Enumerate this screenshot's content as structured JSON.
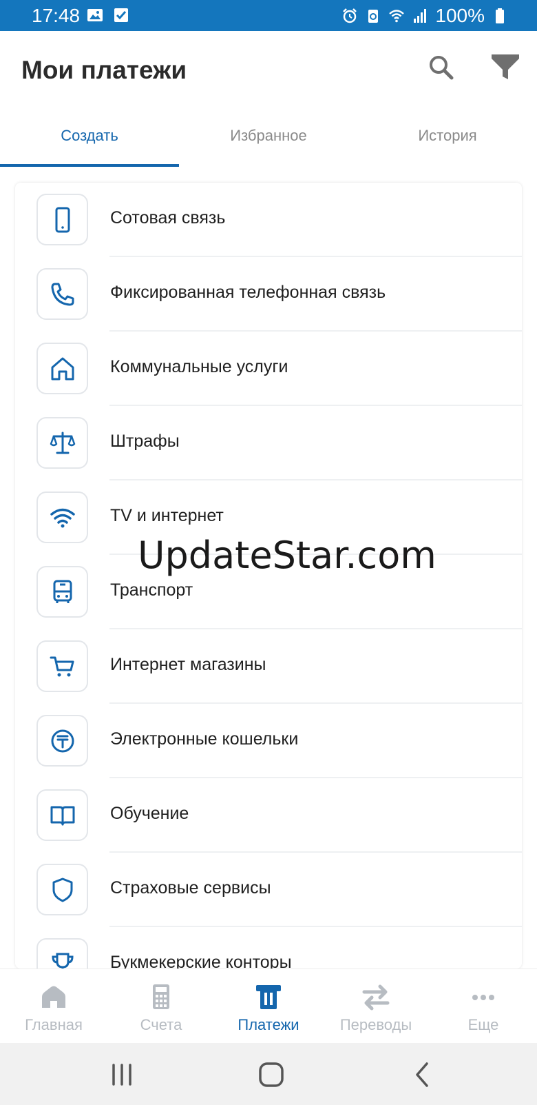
{
  "status_bar": {
    "time": "17:48",
    "battery": "100%",
    "background": "#1476bd",
    "icons_left": [
      "image-icon",
      "checkbox-icon"
    ],
    "icons_right": [
      "alarm-icon",
      "recycle-icon",
      "wifi-icon",
      "signal-icon",
      "battery-icon"
    ]
  },
  "header": {
    "title": "Мои платежи",
    "actions": [
      "search-icon",
      "filter-icon"
    ]
  },
  "tabs": [
    {
      "label": "Создать",
      "active": true
    },
    {
      "label": "Избранное",
      "active": false
    },
    {
      "label": "История",
      "active": false
    }
  ],
  "categories": [
    {
      "label": "Сотовая связь",
      "icon": "mobile-phone-icon"
    },
    {
      "label": "Фиксированная телефонная связь",
      "icon": "phone-handset-icon"
    },
    {
      "label": "Коммунальные услуги",
      "icon": "house-icon"
    },
    {
      "label": "Штрафы",
      "icon": "scales-icon"
    },
    {
      "label": "TV и интернет",
      "icon": "wifi-icon"
    },
    {
      "label": "Транспорт",
      "icon": "bus-icon"
    },
    {
      "label": "Интернет магазины",
      "icon": "shopping-cart-icon"
    },
    {
      "label": "Электронные кошельки",
      "icon": "tenge-coin-icon"
    },
    {
      "label": "Обучение",
      "icon": "book-icon"
    },
    {
      "label": "Страховые сервисы",
      "icon": "shield-icon"
    },
    {
      "label": "Букмекерские конторы",
      "icon": "trophy-icon"
    }
  ],
  "watermark": "UpdateStar.com",
  "bottom_nav": [
    {
      "label": "Главная",
      "icon": "home-icon",
      "active": false
    },
    {
      "label": "Счета",
      "icon": "calculator-icon",
      "active": false
    },
    {
      "label": "Платежи",
      "icon": "payments-icon",
      "active": true
    },
    {
      "label": "Переводы",
      "icon": "transfer-arrows-icon",
      "active": false
    },
    {
      "label": "Еще",
      "icon": "more-dots-icon",
      "active": false
    }
  ],
  "system_nav": [
    "recent-apps-icon",
    "home-button-icon",
    "back-icon"
  ],
  "colors": {
    "accent": "#1466ad",
    "inactive": "#b7bcc2",
    "tab_inactive": "#8a8a8a"
  }
}
